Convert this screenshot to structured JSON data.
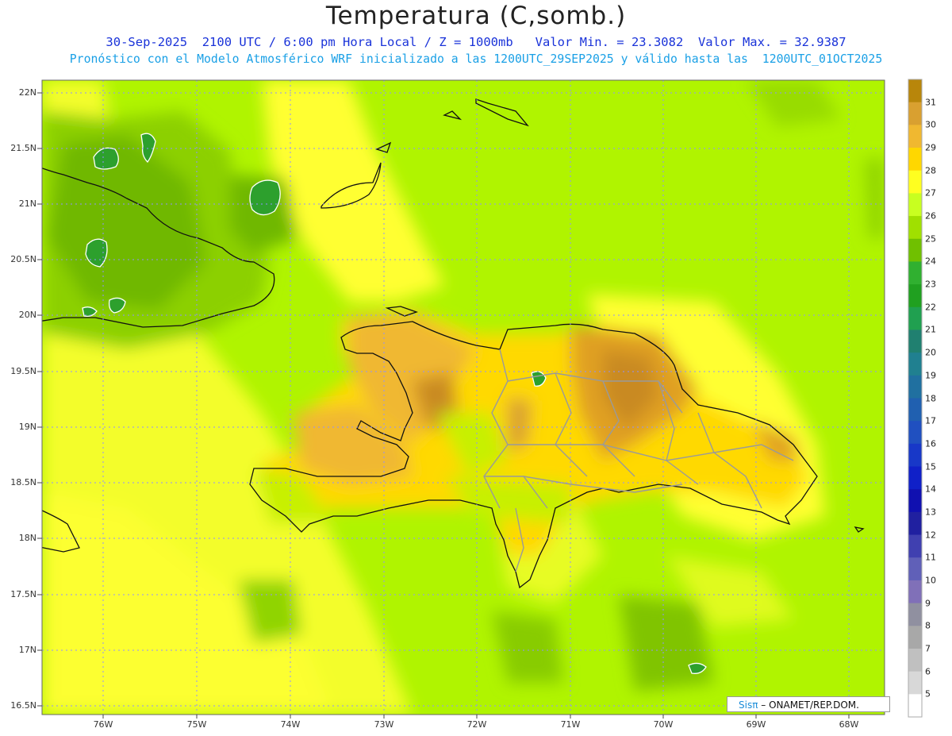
{
  "title": "Temperatura (C,somb.)",
  "subtitle_line1": "30-Sep-2025  2100 UTC / 6:00 pm Hora Local / Z = 1000mb   Valor Min. = 23.3082  Valor Max. = 32.9387",
  "subtitle_line2": "Pronóstico con el Modelo Atmosférico WRF inicializado a las 1200UTC_29SEP2025 y válido hasta las  1200UTC_01OCT2025",
  "lat_labels": [
    "22N",
    "21.5N",
    "21N",
    "20.5N",
    "20N",
    "19.5N",
    "19N",
    "18.5N",
    "18N",
    "17.5N",
    "17N",
    "16.5N"
  ],
  "lon_labels": [
    "76W",
    "75W",
    "74W",
    "73W",
    "72W",
    "71W",
    "70W",
    "69W",
    "68W"
  ],
  "colorbar": {
    "labels": [
      "31",
      "30",
      "29",
      "28",
      "27",
      "26",
      "25",
      "24",
      "23",
      "22",
      "21",
      "20",
      "19",
      "18",
      "17",
      "16",
      "15",
      "14",
      "13",
      "12",
      "11",
      "10",
      "9",
      "8",
      "7",
      "6",
      "5"
    ],
    "colors": [
      "#b8860b",
      "#d9a030",
      "#f0b830",
      "#ffd700",
      "#ffff20",
      "#c8ff20",
      "#a0e000",
      "#70c000",
      "#30b030",
      "#20a020",
      "#20a050",
      "#208070",
      "#208090",
      "#2070a0",
      "#2060b0",
      "#2050c0",
      "#1838c8",
      "#1020c8",
      "#1010b0",
      "#2020a0",
      "#4040b0",
      "#6060b8",
      "#8070b8",
      "#9090a0",
      "#a8a8a8",
      "#c0c0c0",
      "#d8d8d8",
      "#ffffff"
    ]
  },
  "credit": {
    "brand": "Sisπ",
    "text": " – ONAMET/REP.DOM."
  }
}
